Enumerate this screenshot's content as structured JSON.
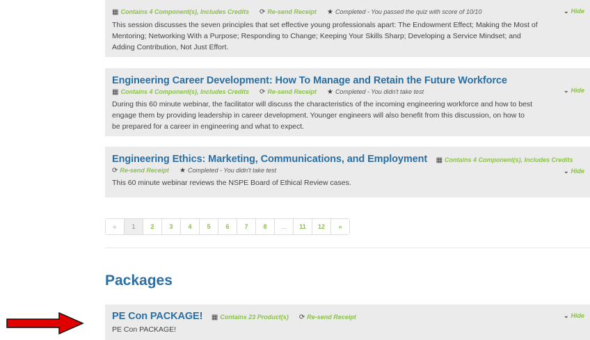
{
  "courses": [
    {
      "title": "",
      "components": "Contains 4 Component(s), Includes Credits",
      "resend": "Re-send Receipt",
      "status": "Completed - You passed the quiz with score of 10/10",
      "hide": "Hide",
      "description_lines": [
        "This session discusses the seven principles that set effective young professionals apart: The Endowment Effect; Making the Most of",
        "Mentoring; Networking With a Purpose; Responding to Change; Keeping Your Skills Sharp; Developing a Service Mindset; and",
        "Adding Contribution, Not Just Effort."
      ]
    },
    {
      "title": "Engineering Career Development: How To Manage and Retain the Future Workforce",
      "components": "Contains 4 Component(s), Includes Credits",
      "resend": "Re-send Receipt",
      "status": "Completed - You didn't take test",
      "hide": "Hide",
      "description_lines": [
        "During this 60 minute webinar, the facilitator will discuss the characteristics of the incoming engineering workforce and how to best",
        "engage them by providing leadership in career development. Younger engineers will also benefit from this discussion, on how to",
        "be prepared for a career in engineering and what to expect."
      ]
    },
    {
      "title": "Engineering Ethics: Marketing, Communications, and Employment",
      "components": "Contains 4 Component(s), Includes Credits",
      "resend": "Re-send Receipt",
      "status": "Completed - You didn't take test",
      "hide": "Hide",
      "description_lines": [
        "This 60 minute webinar reviews the NSPE Board of Ethical Review cases."
      ]
    }
  ],
  "pagination": [
    "«",
    "1",
    "2",
    "3",
    "4",
    "5",
    "6",
    "7",
    "8",
    "...",
    "11",
    "12",
    "»"
  ],
  "packages_heading": "Packages",
  "package": {
    "title": "PE Con PACKAGE!",
    "products": "Contains 23 Product(s)",
    "resend": "Re-send Receipt",
    "hide": "Hide",
    "description": "PE Con PACKAGE!"
  },
  "colors": {
    "title": "#2a6fa3",
    "link": "#8cc04a",
    "panel": "#ebebeb",
    "arrow": "#e00000"
  }
}
